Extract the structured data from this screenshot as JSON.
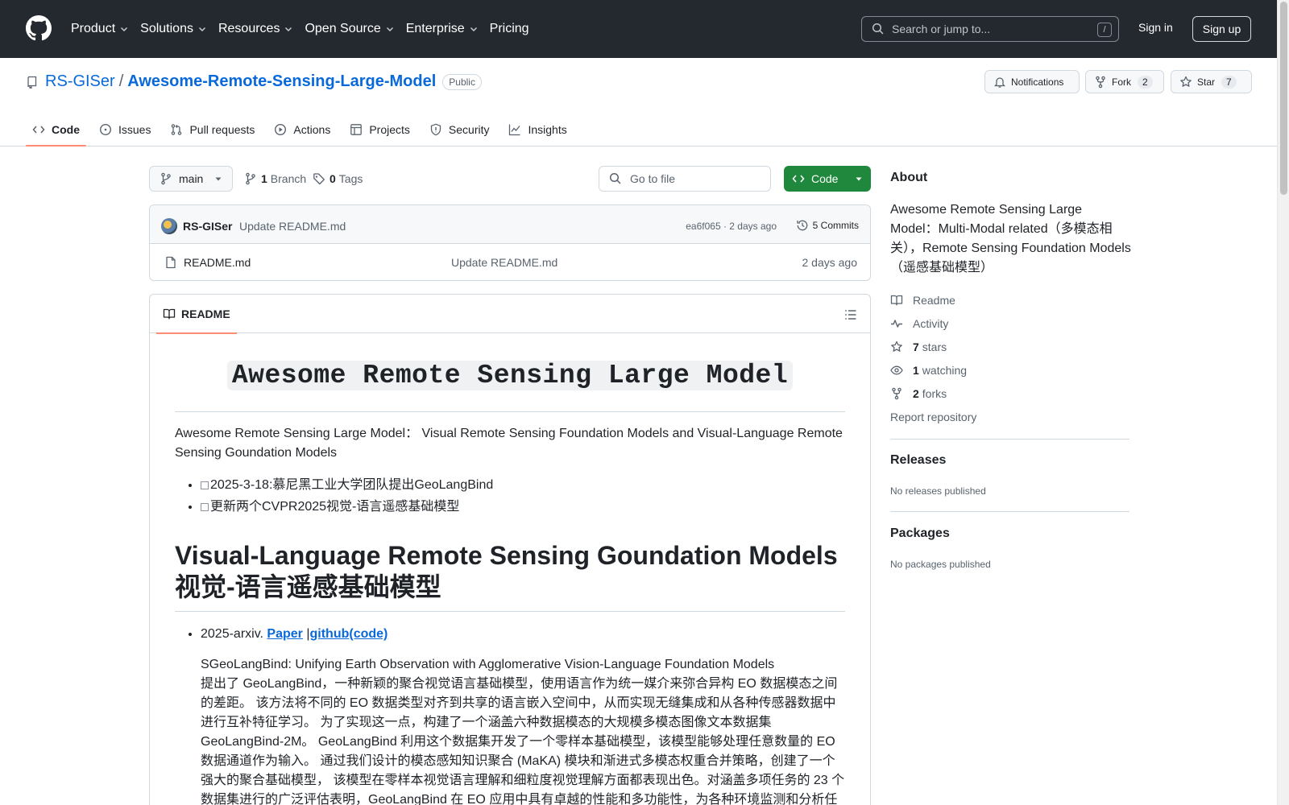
{
  "header": {
    "nav": [
      {
        "label": "Product",
        "has_menu": true
      },
      {
        "label": "Solutions",
        "has_menu": true
      },
      {
        "label": "Resources",
        "has_menu": true
      },
      {
        "label": "Open Source",
        "has_menu": true
      },
      {
        "label": "Enterprise",
        "has_menu": true
      },
      {
        "label": "Pricing",
        "has_menu": false
      }
    ],
    "search_placeholder": "Search or jump to...",
    "search_shortcut": "/",
    "sign_in": "Sign in",
    "sign_up": "Sign up"
  },
  "repo": {
    "owner": "RS-GISer",
    "separator": "/",
    "name": "Awesome-Remote-Sensing-Large-Model",
    "visibility": "Public",
    "notifications_label": "Notifications",
    "fork_label": "Fork",
    "fork_count": "2",
    "star_label": "Star",
    "star_count": "7",
    "tabs": [
      {
        "label": "Code",
        "icon": "code-icon",
        "active": true
      },
      {
        "label": "Issues",
        "icon": "issue-icon",
        "active": false
      },
      {
        "label": "Pull requests",
        "icon": "pull-request-icon",
        "active": false
      },
      {
        "label": "Actions",
        "icon": "play-icon",
        "active": false
      },
      {
        "label": "Projects",
        "icon": "table-icon",
        "active": false
      },
      {
        "label": "Security",
        "icon": "shield-icon",
        "active": false
      },
      {
        "label": "Insights",
        "icon": "graph-icon",
        "active": false
      }
    ]
  },
  "toolbar": {
    "branch": "main",
    "branch_count": "1",
    "branch_label": "Branch",
    "tag_count": "0",
    "tag_label": "Tags",
    "goto_placeholder": "Go to file",
    "code_button": "Code"
  },
  "commit": {
    "author": "RS-GISer",
    "message": "Update README.md",
    "meta": "ea6f065 · 2 days ago",
    "commits_label": "5 Commits"
  },
  "files": [
    {
      "name": "README.md",
      "message": "Update README.md",
      "time": "2 days ago"
    }
  ],
  "readme": {
    "tab_label": "README",
    "title": "Awesome Remote Sensing Large Model",
    "intro": "Awesome Remote Sensing Large Model： Visual Remote Sensing Foundation Models and Visual-Language Remote Sensing Goundation Models",
    "news": [
      "2025-3-18:慕尼黑工业大学团队提出GeoLangBind",
      "更新两个CVPR2025视觉-语言遥感基础模型"
    ],
    "section_title_en": "Visual-Language Remote Sensing Goundation Models",
    "section_title_zh": "视觉-语言遥感基础模型",
    "entry_prefix": "2025-arxiv.",
    "entry_paper": "Paper",
    "entry_sep": "|",
    "entry_code": "github(code)",
    "entry_title": "SGeoLangBind: Unifying Earth Observation with Agglomerative Vision-Language Foundation Models",
    "entry_desc": "提出了 GeoLangBind，一种新颖的聚合视觉语言基础模型，使用语言作为统一媒介来弥合异构 EO 数据模态之间的差距。 该方法将不同的 EO 数据类型对齐到共享的语言嵌入空间中，从而实现无缝集成和从各种传感器数据中进行互补特征学习。 为了实现这一点，构建了一个涵盖六种数据模态的大规模多模态图像文本数据集 GeoLangBind-2M。 GeoLangBind 利用这个数据集开发了一个零样本基础模型，该模型能够处理任意数量的 EO 数据通道作为输入。 通过我们设计的模态感知知识聚合 (MaKA) 模块和渐进式多模态权重合并策略，创建了一个强大的聚合基础模型， 该模型在零样本视觉语言理解和细粒度视觉理解方面都表现出色。对涵盖多项任务的 23 个数据集进行的广泛评估表明，GeoLangBind 在 EO 应用中具有卓越的性能和多功能性，为各种环境监测和分析任务提供了强大的框架。"
  },
  "about": {
    "title": "About",
    "description": "Awesome Remote Sensing Large Model：Multi-Modal related（多模态相关），Remote Sensing Foundation Models（遥感基础模型）",
    "readme_link": "Readme",
    "activity_link": "Activity",
    "stars_count": "7",
    "stars_label": "stars",
    "watching_count": "1",
    "watching_label": "watching",
    "forks_count": "2",
    "forks_label": "forks",
    "report": "Report repository"
  },
  "releases": {
    "title": "Releases",
    "note": "No releases published"
  },
  "packages": {
    "title": "Packages",
    "note": "No packages published"
  },
  "colors": {
    "header_bg": "#24292f",
    "link_blue": "#0969da",
    "code_green": "#1f883d",
    "tab_underline": "#fd8c73"
  }
}
